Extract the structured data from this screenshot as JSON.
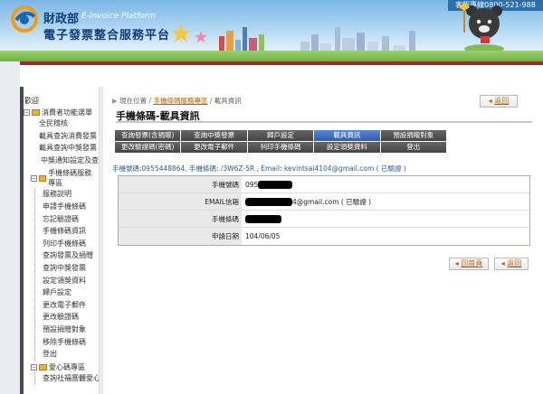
{
  "header": {
    "hotline": "客服專線0800-521-988",
    "ministry": "財政部",
    "ministry_en": "E-Invoice Platform",
    "platform": "電子發票整合服務平台"
  },
  "sidebar": {
    "title": "歡迎",
    "section1": "消費者功能選單",
    "items_top": [
      "全民稽核",
      "載具查詢消費發票",
      "載具查詢中獎發票",
      "中獎通知設定及查詢"
    ],
    "section2": "手機條碼服務專區",
    "items_mobile": [
      "服務說明",
      "申請手機條碼",
      "忘記驗證碼",
      "手機條碼資訊",
      "列印手機條碼",
      "查詢發票及捐贈",
      "查詢中獎發票",
      "設定領獎資料",
      "歸戶設定",
      "更改電子郵件",
      "更改驗證碼",
      "預設捐贈對象",
      "移除手機條碼",
      "登出"
    ],
    "section3": "愛心碼專區",
    "items_love": [
      "查詢社福團體愛心碼"
    ]
  },
  "main": {
    "breadcrumb": {
      "prefix": "現在位置 /",
      "link": "手機條碼服務專區",
      "sep": "/",
      "current": "載具資訊"
    },
    "back_label": "返回",
    "title": "手機條碼-載具資訊",
    "tabs": [
      {
        "label": "查詢發票(含捐贈)",
        "active": false
      },
      {
        "label": "查詢中獎發票",
        "active": false
      },
      {
        "label": "歸戶設定",
        "active": false
      },
      {
        "label": "載具資訊",
        "active": true
      },
      {
        "label": "預設捐贈對象",
        "active": false
      },
      {
        "label": "更改驗證碼(密碼)",
        "active": false
      },
      {
        "label": "更改電子郵件",
        "active": false
      },
      {
        "label": "列印手機條碼",
        "active": false
      },
      {
        "label": "設定領獎資料",
        "active": false
      },
      {
        "label": "登出",
        "active": false
      }
    ],
    "info_line": "手機號碼:0955448864, 手機條碼: /3W6Z-5R , Email: kevintsai4104@gmail.com ( 已驗證 )",
    "table": {
      "phone_label": "手機號碼",
      "phone_value": "095",
      "email_label": "EMAIL信箱",
      "email_value": "4@gmail.com ( 已驗證 )",
      "barcode_label": "手機條碼",
      "date_label": "申請日期",
      "date_value": "104/06/05"
    },
    "home_label": "回首頁",
    "back2_label": "返回"
  }
}
